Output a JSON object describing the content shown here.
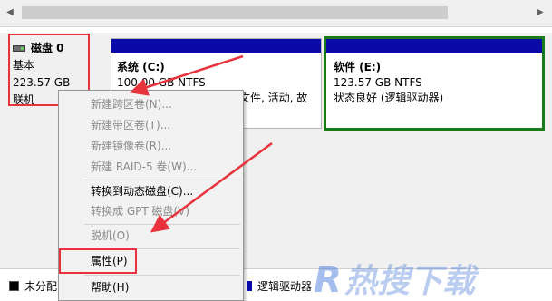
{
  "disk": {
    "title": "磁盘 0",
    "type": "基本",
    "size": "223.57 GB",
    "status": "联机"
  },
  "partitions": {
    "c": {
      "name": "系统  (C:)",
      "size_fs": "100.00 GB NTFS",
      "status_fragment": "文件, 活动, 故"
    },
    "e": {
      "name": "软件  (E:)",
      "size_fs": "123.57 GB NTFS",
      "status": "状态良好 (逻辑驱动器)"
    }
  },
  "context_menu": {
    "items": [
      {
        "label": "新建跨区卷(N)...",
        "enabled": false
      },
      {
        "label": "新建带区卷(T)...",
        "enabled": false
      },
      {
        "label": "新建镜像卷(R)...",
        "enabled": false
      },
      {
        "label": "新建 RAID-5 卷(W)...",
        "enabled": false
      },
      {
        "label": "转换到动态磁盘(C)...",
        "enabled": true
      },
      {
        "label": "转换成 GPT 磁盘(V)",
        "enabled": false
      },
      {
        "label": "脱机(O)",
        "enabled": false
      },
      {
        "label": "属性(P)",
        "enabled": true
      },
      {
        "label": "帮助(H)",
        "enabled": true
      }
    ]
  },
  "legend": {
    "unallocated": "未分配",
    "logical_drive": "逻辑驱动器"
  },
  "watermark": {
    "text": "R热搜下载"
  },
  "colors": {
    "partition_bar": "#0a0aa8",
    "highlight_red": "#e8323c",
    "selected_partition_border": "#1a7a1a",
    "disabled_text": "#8c8c8c"
  }
}
